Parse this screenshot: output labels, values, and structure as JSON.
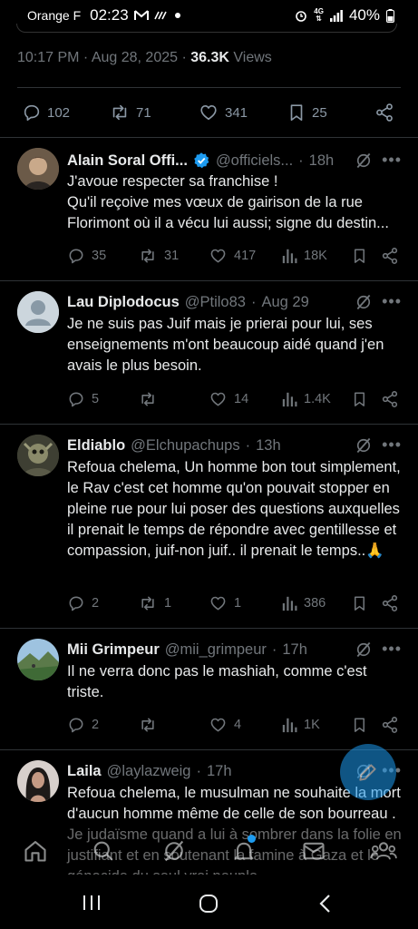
{
  "status_bar": {
    "carrier": "Orange F",
    "time": "02:23",
    "battery": "40%",
    "network": "4G"
  },
  "main_tweet": {
    "time": "10:17 PM",
    "date": "Aug 28, 2025",
    "views_count": "36.3K",
    "views_label": "Views",
    "replies": "102",
    "reposts": "71",
    "likes": "341",
    "bookmarks": "25"
  },
  "replies": [
    {
      "name": "Alain Soral Offi...",
      "verified": true,
      "handle": "@officiels...",
      "time": "18h",
      "text": "J'avoue respecter sa franchise !\nQu'il reçoive mes vœux de gairison de la rue Florimont où il a vécu lui aussi; signe du destin...",
      "replies": "35",
      "reposts": "31",
      "likes": "417",
      "views": "18K"
    },
    {
      "name": "Lau Diplodocus",
      "handle": "@Ptilo83",
      "time": "Aug 29",
      "text": "Je ne suis pas Juif mais je prierai pour lui, ses enseignements m'ont beaucoup aidé quand j'en avais le plus besoin.",
      "replies": "5",
      "reposts": "",
      "likes": "14",
      "views": "1.4K"
    },
    {
      "name": "Eldiablo",
      "handle": "@Elchupachups",
      "time": "13h",
      "text": "Refoua chelema, Un homme bon tout simplement, le Rav c'est cet homme qu'on pouvait stopper en pleine rue pour lui poser des questions auxquelles il prenait le temps de répondre avec gentillesse et compassion, juif-non juif.. il prenait le temps..🙏",
      "replies": "2",
      "reposts": "1",
      "likes": "1",
      "views": "386"
    },
    {
      "name": "Mii Grimpeur",
      "handle": "@mii_grimpeur",
      "time": "17h",
      "text": "Il ne verra donc pas le mashiah, comme c'est triste.",
      "replies": "2",
      "reposts": "",
      "likes": "4",
      "views": "1K"
    },
    {
      "name": "Laila",
      "handle": "@laylazweig",
      "time": "17h",
      "text": "Refoua chelema, le musulman ne souhaite la mort d'aucun homme même de celle de son bourreau . Je judaïsme quand a lui à sombrer dans la folie en justifiant et en soutenant la famine à Gaza et le génocide du seul vrai peuple"
    }
  ],
  "colors": {
    "background": "#000000",
    "text": "#e7e9ea",
    "muted": "#71767b",
    "divider": "#2f3336",
    "accent": "#1d9bf0",
    "verified": "#1d9bf0"
  },
  "icons": [
    "reply-icon",
    "repost-icon",
    "like-icon",
    "views-icon",
    "bookmark-icon",
    "share-icon",
    "grok-icon",
    "more-icon",
    "home-icon",
    "search-icon",
    "grok-tab-icon",
    "notifications-icon",
    "messages-icon",
    "communities-icon"
  ]
}
